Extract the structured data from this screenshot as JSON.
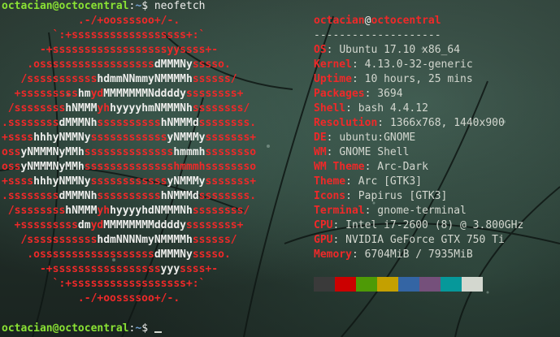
{
  "terminal": {
    "prompt1": {
      "user_host": "octacian@octocentral",
      "sep": ":",
      "path": "~",
      "sigil": "$",
      "command": "neofetch"
    },
    "prompt2": {
      "user_host": "octacian@octocentral",
      "sep": ":",
      "path": "~",
      "sigil": "$",
      "command": ""
    }
  },
  "logo": {
    "lines": [
      [
        [
          "r",
          "            .-/+oossssoo+/-.           "
        ]
      ],
      [
        [
          "r",
          "        `:+ssssssssssssssssss+:`       "
        ]
      ],
      [
        [
          "r",
          "      -+ssssssssssssssssssyyssss+-     "
        ]
      ],
      [
        [
          "r",
          "    .ossssssssssssssssss"
        ],
        [
          "w",
          "dMMMNy"
        ],
        [
          "r",
          "sssso.   "
        ]
      ],
      [
        [
          "r",
          "   /sssssssssss"
        ],
        [
          "w",
          "hdmmNNmmyNMMMMh"
        ],
        [
          "r",
          "ssssss/  "
        ]
      ],
      [
        [
          "r",
          "  +sssssssss"
        ],
        [
          "w",
          "hm"
        ],
        [
          "r",
          "yd"
        ],
        [
          "w",
          "MMMMMMMNddddy"
        ],
        [
          "r",
          "ssssssss+ "
        ]
      ],
      [
        [
          "r",
          " /ssssssss"
        ],
        [
          "w",
          "hNMMM"
        ],
        [
          "r",
          "yh"
        ],
        [
          "w",
          "hyyyyhmNMMMNh"
        ],
        [
          "r",
          "ssssssss/ "
        ]
      ],
      [
        [
          "r",
          ".ssssssss"
        ],
        [
          "w",
          "dMMMNh"
        ],
        [
          "r",
          "ssssssssss"
        ],
        [
          "w",
          "hNMMMd"
        ],
        [
          "r",
          "ssssssss."
        ]
      ],
      [
        [
          "r",
          "+ssss"
        ],
        [
          "w",
          "hhhyNMMNy"
        ],
        [
          "r",
          "ssssssssssss"
        ],
        [
          "w",
          "yNMMMy"
        ],
        [
          "r",
          "sssssss+"
        ]
      ],
      [
        [
          "r",
          "oss"
        ],
        [
          "w",
          "yNMMMNyMMh"
        ],
        [
          "r",
          "ssssssssssssss"
        ],
        [
          "w",
          "hmmmh"
        ],
        [
          "r",
          "ssssssso"
        ]
      ],
      [
        [
          "r",
          "oss"
        ],
        [
          "w",
          "yNMMMNyMMh"
        ],
        [
          "r",
          "sssssssssssssshmmmhssssssso"
        ]
      ],
      [
        [
          "r",
          "+ssss"
        ],
        [
          "w",
          "hhhyNMMNy"
        ],
        [
          "r",
          "ssssssssssss"
        ],
        [
          "w",
          "yNMMMy"
        ],
        [
          "r",
          "sssssss+"
        ]
      ],
      [
        [
          "r",
          ".ssssssss"
        ],
        [
          "w",
          "dMMMNh"
        ],
        [
          "r",
          "ssssssssss"
        ],
        [
          "w",
          "hNMMMd"
        ],
        [
          "r",
          "ssssssss."
        ]
      ],
      [
        [
          "r",
          " /ssssssss"
        ],
        [
          "w",
          "hNMMM"
        ],
        [
          "r",
          "yh"
        ],
        [
          "w",
          "hyyyyhdNMMMNh"
        ],
        [
          "r",
          "ssssssss/ "
        ]
      ],
      [
        [
          "r",
          "  +sssssssss"
        ],
        [
          "w",
          "dm"
        ],
        [
          "r",
          "yd"
        ],
        [
          "w",
          "MMMMMMMMddddy"
        ],
        [
          "r",
          "ssssssss+ "
        ]
      ],
      [
        [
          "r",
          "   /sssssssssss"
        ],
        [
          "w",
          "hdmNNNNmyNMMMMh"
        ],
        [
          "r",
          "ssssss/  "
        ]
      ],
      [
        [
          "r",
          "    .ossssssssssssssssss"
        ],
        [
          "w",
          "dMMMNy"
        ],
        [
          "r",
          "sssso.   "
        ]
      ],
      [
        [
          "r",
          "      -+sssssssssssssssss"
        ],
        [
          "w",
          "yyy"
        ],
        [
          "r",
          "ssss+-     "
        ]
      ],
      [
        [
          "r",
          "        `:+ssssssssssssssssss+:`       "
        ]
      ],
      [
        [
          "r",
          "            .-/+oossssoo+/-.           "
        ]
      ]
    ]
  },
  "info": {
    "user": "octacian",
    "at": "@",
    "host": "octocentral",
    "separator": "--------------------",
    "rows": [
      {
        "key": "OS",
        "value": "Ubuntu 17.10 x86_64"
      },
      {
        "key": "Kernel",
        "value": "4.13.0-32-generic"
      },
      {
        "key": "Uptime",
        "value": "10 hours, 25 mins"
      },
      {
        "key": "Packages",
        "value": "3694"
      },
      {
        "key": "Shell",
        "value": "bash 4.4.12"
      },
      {
        "key": "Resolution",
        "value": "1366x768, 1440x900"
      },
      {
        "key": "DE",
        "value": "ubuntu:GNOME"
      },
      {
        "key": "WM",
        "value": "GNOME Shell"
      },
      {
        "key": "WM Theme",
        "value": "Arc-Dark"
      },
      {
        "key": "Theme",
        "value": "Arc [GTK3]"
      },
      {
        "key": "Icons",
        "value": "Papirus [GTK3]"
      },
      {
        "key": "Terminal",
        "value": "gnome-terminal"
      },
      {
        "key": "CPU",
        "value": "Intel i7-2600 (8) @ 3.800GHz"
      },
      {
        "key": "GPU",
        "value": "NVIDIA GeForce GTX 750 Ti"
      },
      {
        "key": "Memory",
        "value": "6704MiB / 7935MiB"
      }
    ],
    "palette": [
      "#3a3a3a",
      "#cc0000",
      "#4e9a06",
      "#c4a000",
      "#3465a4",
      "#75507b",
      "#06989a",
      "#d3d7cf"
    ]
  }
}
